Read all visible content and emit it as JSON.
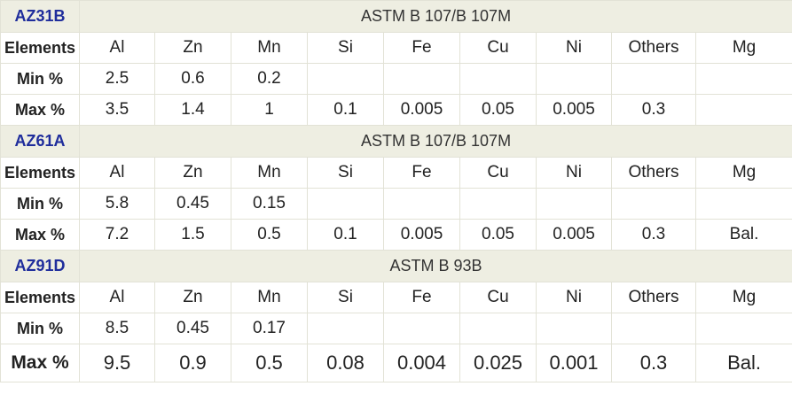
{
  "groups": [
    {
      "grade": "AZ31B",
      "standard": "ASTM B 107/B 107M",
      "elements_label": "Elements",
      "headers": [
        "Al",
        "Zn",
        "Mn",
        "Si",
        "Fe",
        "Cu",
        "Ni",
        "Others",
        "Mg"
      ],
      "min_label": "Min %",
      "min": [
        "2.5",
        "0.6",
        "0.2",
        "",
        "",
        "",
        "",
        "",
        ""
      ],
      "max_label": "Max %",
      "max": [
        "3.5",
        "1.4",
        "1",
        "0.1",
        "0.005",
        "0.05",
        "0.005",
        "0.3",
        ""
      ]
    },
    {
      "grade": "AZ61A",
      "standard": "ASTM B 107/B 107M",
      "elements_label": "Elements",
      "headers": [
        "Al",
        "Zn",
        "Mn",
        "Si",
        "Fe",
        "Cu",
        "Ni",
        "Others",
        "Mg"
      ],
      "min_label": "Min %",
      "min": [
        "5.8",
        "0.45",
        "0.15",
        "",
        "",
        "",
        "",
        "",
        ""
      ],
      "max_label": "Max %",
      "max": [
        "7.2",
        "1.5",
        "0.5",
        "0.1",
        "0.005",
        "0.05",
        "0.005",
        "0.3",
        "Bal."
      ]
    },
    {
      "grade": "AZ91D",
      "standard": "ASTM B 93B",
      "elements_label": "Elements",
      "headers": [
        "Al",
        "Zn",
        "Mn",
        "Si",
        "Fe",
        "Cu",
        "Ni",
        "Others",
        "Mg"
      ],
      "min_label": "Min %",
      "min": [
        "8.5",
        "0.45",
        "0.17",
        "",
        "",
        "",
        "",
        "",
        ""
      ],
      "max_label": "Max %",
      "max": [
        "9.5",
        "0.9",
        "0.5",
        "0.08",
        "0.004",
        "0.025",
        "0.001",
        "0.3",
        "Bal."
      ]
    }
  ]
}
